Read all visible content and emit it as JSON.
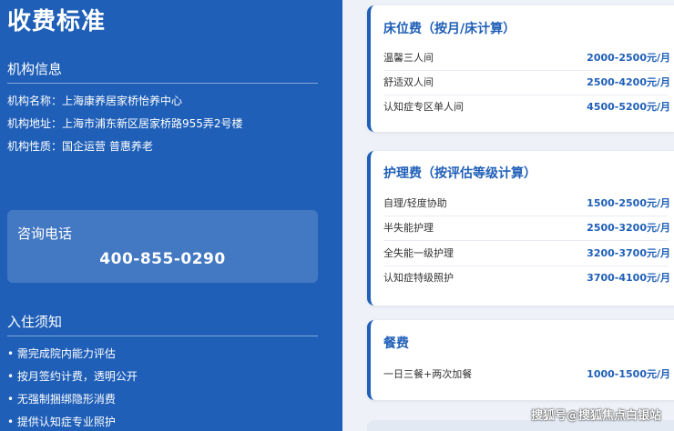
{
  "left": {
    "title": "收费标准",
    "institution": {
      "heading": "机构信息",
      "lines": [
        "机构名称：上海康养居家桥怡养中心",
        "机构地址：上海市浦东新区居家桥路955弄2号楼",
        "机构性质：国企运营 普惠养老"
      ]
    },
    "consult": {
      "label": "咨询电话",
      "phone": "400-855-0290"
    },
    "notice": {
      "heading": "入住须知",
      "items": [
        "• 需完成院内能力评估",
        "• 按月签约计费，透明公开",
        "• 无强制捆绑隐形消费",
        "• 提供认知症专业照护"
      ]
    }
  },
  "cards": [
    {
      "title": "床位费（按月/床计算）",
      "rows": [
        {
          "label": "温馨三人间",
          "price": "2000-2500元/月"
        },
        {
          "label": "舒适双人间",
          "price": "2500-4200元/月"
        },
        {
          "label": "认知症专区单人间",
          "price": "4500-5200元/月"
        }
      ]
    },
    {
      "title": "护理费（按评估等级计算）",
      "rows": [
        {
          "label": "自理/轻度协助",
          "price": "1500-2500元/月"
        },
        {
          "label": "半失能护理",
          "price": "2500-3200元/月"
        },
        {
          "label": "全失能一级护理",
          "price": "3200-3700元/月"
        },
        {
          "label": "认知症特级照护",
          "price": "3700-4100元/月"
        }
      ]
    },
    {
      "title": "餐费",
      "rows": [
        {
          "label": "一日三餐+两次加餐",
          "price": "1000-1500元/月"
        }
      ]
    }
  ],
  "watermark": "搜狐号@搜狐焦点白银站",
  "colors": {
    "primary": "#1f5fb8",
    "panel_bg": "#eef2f8"
  }
}
